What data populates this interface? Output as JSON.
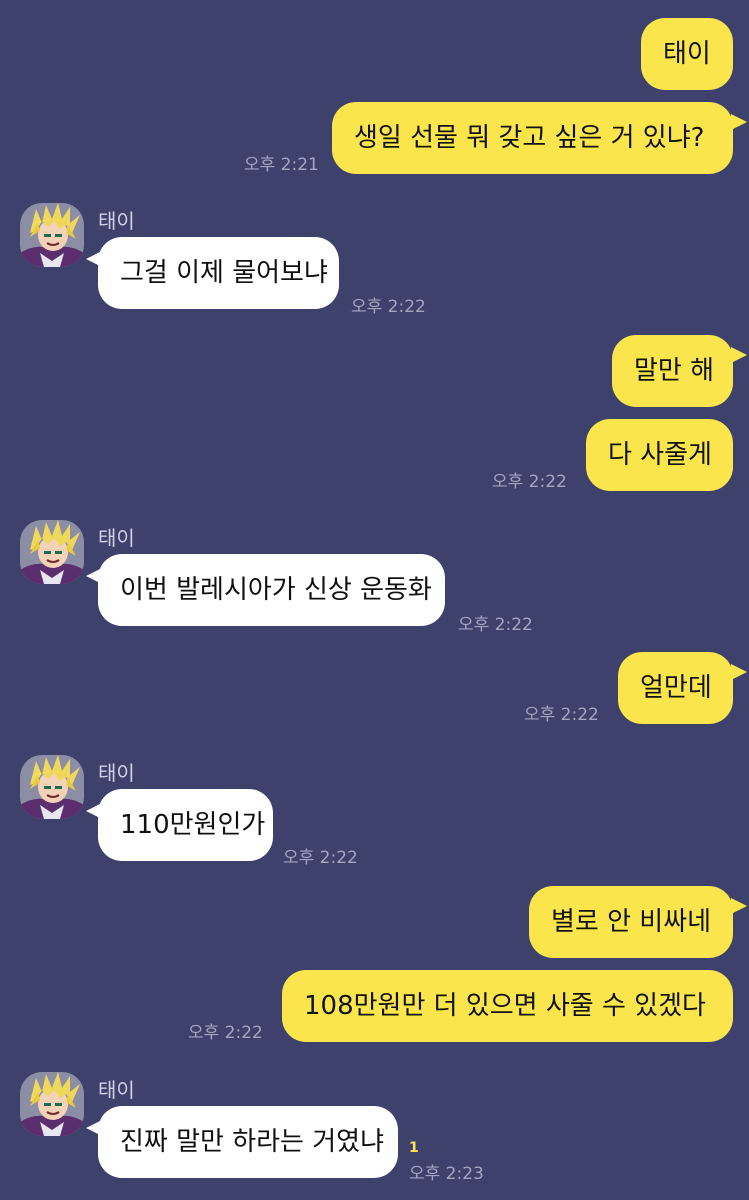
{
  "messages": {
    "m1": "태이",
    "m2": "생일 선물 뭐 갖고 싶은 거 있냐?",
    "m3": "그걸 이제 물어보냐",
    "m4": "말만 해",
    "m5": "다 사줄게",
    "m6": "이번 발레시아가 신상 운동화",
    "m7": "얼만데",
    "m8": "110만원인가",
    "m9": "별로 안 비싸네",
    "m10": "108만원만 더 있으면 사줄 수 있겠다",
    "m11": "진짜 말만 하라는 거였냐"
  },
  "times": {
    "t1": "오후 2:21",
    "t2": "오후 2:22",
    "t3": "오후 2:22",
    "t4": "오후 2:22",
    "t5": "오후 2:22",
    "t6": "오후 2:22",
    "t7": "오후 2:22",
    "t8": "오후 2:23"
  },
  "sender": {
    "name": "태이",
    "avatar_icon": "anime-character-avatar-icon"
  },
  "unread_count": "1",
  "colors": {
    "background": "#3f416d",
    "outgoing_bubble": "#fae64c",
    "incoming_bubble": "#ffffff"
  }
}
